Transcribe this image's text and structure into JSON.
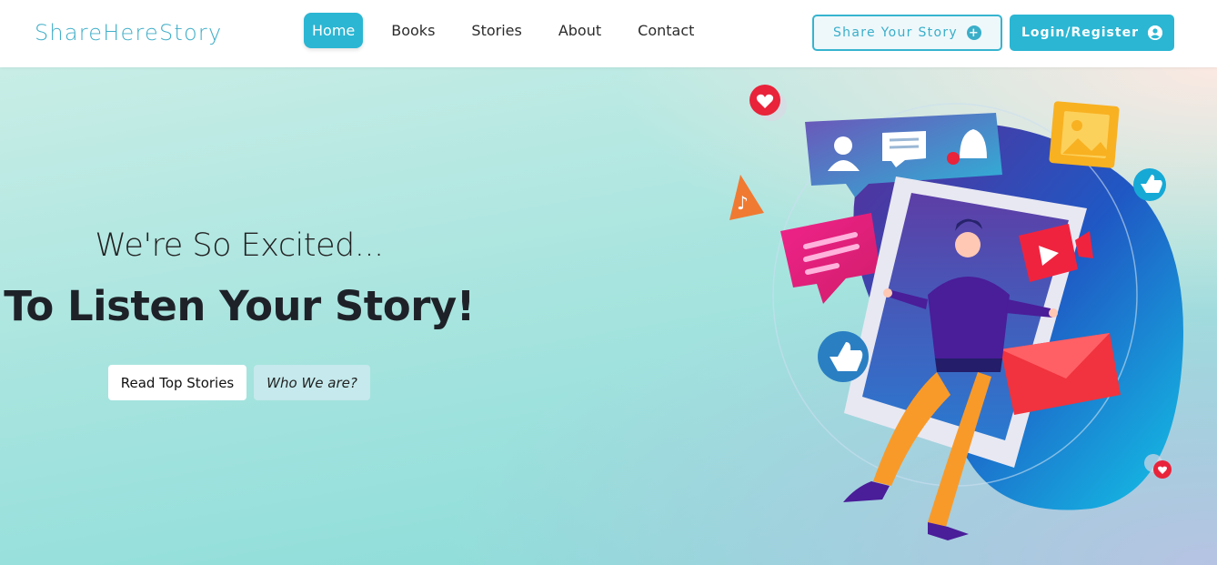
{
  "brand": {
    "name": "ShareHereStory"
  },
  "nav": {
    "items": [
      {
        "label": "Home",
        "active": true
      },
      {
        "label": "Books",
        "active": false
      },
      {
        "label": "Stories",
        "active": false
      },
      {
        "label": "About",
        "active": false
      },
      {
        "label": "Contact",
        "active": false
      }
    ]
  },
  "actions": {
    "share_label": "Share Your Story",
    "share_icon": "plus-circle-icon",
    "login_label": "Login/Register",
    "login_icon": "user-circle-icon"
  },
  "hero": {
    "subtitle": "We're So Excited...",
    "title": "To Listen Your Story!",
    "primary_button": "Read Top Stories",
    "secondary_button": "Who We are?"
  },
  "colors": {
    "accent": "#2bb6d3",
    "brand_text": "#41aec8",
    "hero_gradient_start": "#c8ede6",
    "hero_gradient_end": "#85dbd8"
  }
}
